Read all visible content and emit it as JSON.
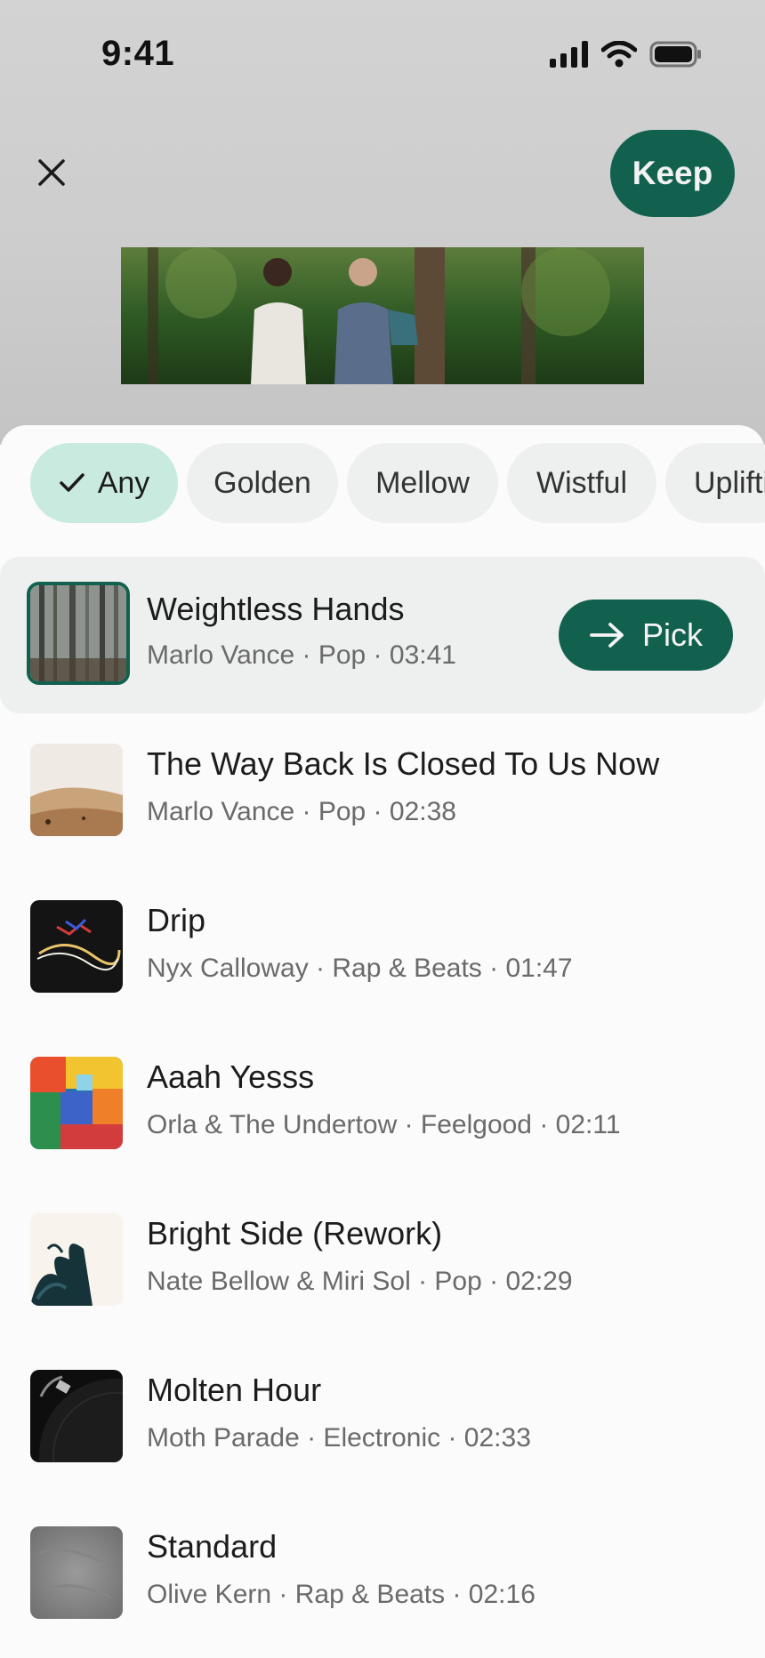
{
  "status_bar": {
    "time": "9:41"
  },
  "header": {
    "keep_label": "Keep"
  },
  "filters": [
    {
      "label": "Any",
      "selected": true
    },
    {
      "label": "Golden",
      "selected": false
    },
    {
      "label": "Mellow",
      "selected": false
    },
    {
      "label": "Wistful",
      "selected": false
    },
    {
      "label": "Uplifti",
      "selected": false
    }
  ],
  "pick_label": "Pick",
  "tracks": [
    {
      "title": "Weightless Hands",
      "meta": "Marlo Vance · Pop · 03:41",
      "selected": true
    },
    {
      "title": "The Way Back Is Closed To Us Now",
      "meta": "Marlo Vance · Pop · 02:38"
    },
    {
      "title": "Drip",
      "meta": "Nyx Calloway · Rap & Beats · 01:47"
    },
    {
      "title": "Aaah Yesss",
      "meta": "Orla & The Undertow · Feelgood · 02:11"
    },
    {
      "title": "Bright Side (Rework)",
      "meta": "Nate Bellow & Miri Sol · Pop · 02:29"
    },
    {
      "title": "Molten Hour",
      "meta": "Moth Parade · Electronic · 02:33"
    },
    {
      "title": "Standard",
      "meta": "Olive Kern · Rap & Beats · 02:16"
    }
  ],
  "colors": {
    "accent": "#12614f",
    "chip_selected": "#c9ebdf",
    "chip_bg": "#eef0ef"
  },
  "icons": [
    "signal-icon",
    "wifi-icon",
    "battery-icon",
    "close-icon",
    "check-icon",
    "arrow-right-icon"
  ]
}
